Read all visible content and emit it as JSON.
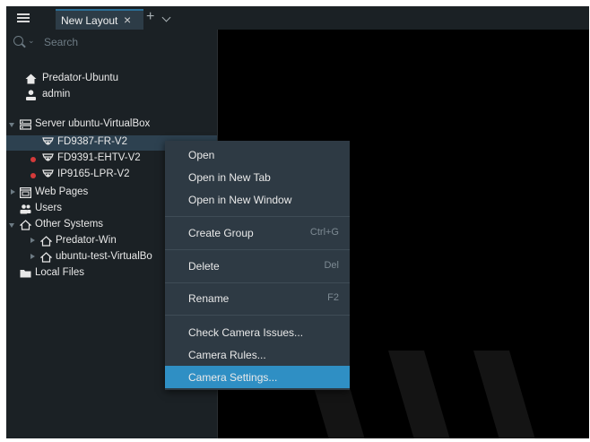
{
  "tabs": {
    "active_label": "New Layout",
    "close_glyph": "×",
    "add_glyph": "+"
  },
  "search": {
    "placeholder": "Search"
  },
  "tree": {
    "user_site": "Predator-Ubuntu",
    "user_name": "admin",
    "server": "Server ubuntu-VirtualBox",
    "cameras": [
      "FD9387-FR-V2",
      "FD9391-EHTV-V2",
      "IP9165-LPR-V2"
    ],
    "web_pages": "Web Pages",
    "users": "Users",
    "other_systems": "Other Systems",
    "other_items": [
      "Predator-Win",
      "ubuntu-test-VirtualBo"
    ],
    "local_files": "Local Files"
  },
  "context_menu": {
    "open": "Open",
    "open_new_tab": "Open in New Tab",
    "open_new_window": "Open in New Window",
    "create_group": "Create Group",
    "create_group_shortcut": "Ctrl+G",
    "delete": "Delete",
    "delete_shortcut": "Del",
    "rename": "Rename",
    "rename_shortcut": "F2",
    "check_issues": "Check Camera Issues...",
    "camera_rules": "Camera Rules...",
    "camera_settings": "Camera Settings..."
  },
  "colors": {
    "panel": "#1b2125",
    "accent": "#2f8fc4",
    "selected_row": "#2d4150",
    "offline_dot": "#d43a3a",
    "menu_bg": "#2e3a44"
  },
  "icons": {
    "menu": "hamburger-icon",
    "search": "search-icon",
    "site": "home-icon",
    "user": "user-icon",
    "server": "server-icon",
    "camera": "camera-icon",
    "web": "web-page-icon",
    "users": "users-icon",
    "system": "house-outline-icon",
    "folder": "folder-icon"
  }
}
